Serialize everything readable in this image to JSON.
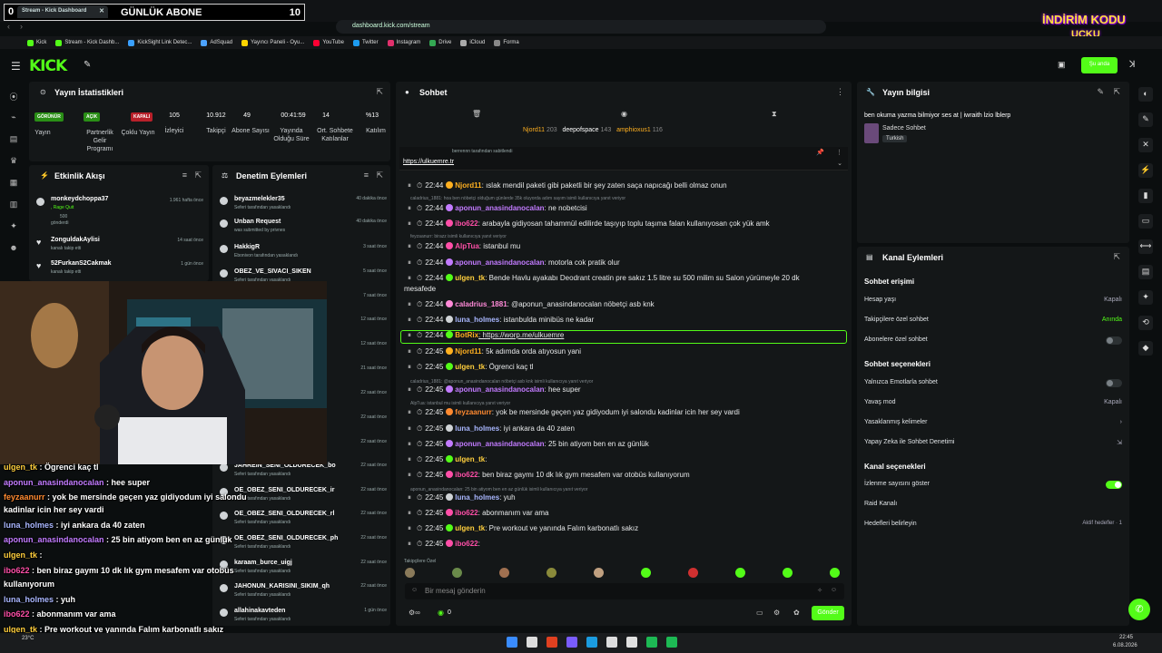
{
  "browser": {
    "tab_title": "Stream - Kick Dashboard",
    "goal_label": "GÜNLÜK ABONE",
    "goal_count": "10",
    "left_digit": "0",
    "url": "dashboard.kick.com/stream"
  },
  "promo": {
    "line1": "İNDİRİM KODU",
    "line2": "UCKU"
  },
  "bookmarks": [
    "Kick",
    "Stream - Kick Dashb...",
    "KickSight Link Detec...",
    "AdSquad",
    "Yayıncı Paneli - Oyu...",
    "YouTube",
    "Twitter",
    "Instagram",
    "Drive",
    "iCloud",
    "Forma"
  ],
  "header": {
    "logo": "KICK",
    "go_live": "Şu anda"
  },
  "stats": {
    "title": "Yayın İstatistikleri",
    "badges": [
      "GÖRÜNÜR",
      "AÇIK",
      "KAPALI"
    ],
    "labels": [
      "Yayın",
      "Partnerlik Gelir Programı",
      "Çoklu Yayın",
      "İzleyici",
      "Takipçi",
      "Abone Sayısı",
      "Yayında Olduğu Süre",
      "Ort. Sohbete Katılanlar",
      "Katılım"
    ],
    "values": [
      "105",
      "10.912",
      "49",
      "00:41:59",
      "14",
      "%13"
    ]
  },
  "activity": {
    "title": "Etkinlik Akışı",
    "items": [
      {
        "user": "monkeydchoppa37",
        "sub": ", Rage Quit",
        "extra": "500",
        "extra2": "gönderdi",
        "time": "1.961 hafta önce"
      },
      {
        "user": "ZonguldakAylisi",
        "sub": "kanalı takip etti",
        "time": "14 saat önce"
      },
      {
        "user": "52FurkanS2Cakmak",
        "sub": "kanalı takip etti",
        "time": "1 gün önce"
      }
    ]
  },
  "moderation": {
    "title": "Denetim Eylemleri",
    "items": [
      {
        "user": "beyazmelekler35",
        "sub": "Seferi tarafından yasaklandı",
        "time": "40 dakika önce"
      },
      {
        "user": "Unban Request",
        "sub": "was submitted by privnes",
        "time": "40 dakika önce"
      },
      {
        "user": "HakkigR",
        "sub": "Ebonivon tarafından yasaklandı",
        "time": "3 saat önce"
      },
      {
        "user": "OBEZ_VE_SIVACI_SIKEN",
        "sub": "Seferi tarafından yasaklandı",
        "time": "5 saat önce"
      },
      {
        "user": "",
        "sub": "",
        "time": "7 saat önce"
      },
      {
        "user": "",
        "sub": "",
        "time": "12 saat önce"
      },
      {
        "user": "",
        "sub": "",
        "time": "12 saat önce"
      },
      {
        "user": "",
        "sub": "",
        "time": "21 saat önce"
      },
      {
        "user": "",
        "sub": "",
        "time": "22 saat önce"
      },
      {
        "user": "",
        "sub": "",
        "time": "22 saat önce"
      },
      {
        "user": "",
        "sub": "",
        "time": "22 saat önce"
      },
      {
        "user": "JAHREIN_SENI_OLDURECEK_bo",
        "sub": "Seferi tarafından yasaklandı",
        "time": "22 saat önce"
      },
      {
        "user": "OE_OBEZ_SENI_OLDURECEK_ir",
        "sub": "Seferi tarafından yasaklandı",
        "time": "22 saat önce"
      },
      {
        "user": "OE_OBEZ_SENI_OLDURECEK_rl",
        "sub": "Seferi tarafından yasaklandı",
        "time": "22 saat önce"
      },
      {
        "user": "OE_OBEZ_SENI_OLDURECEK_ph",
        "sub": "Seferi tarafından yasaklandı",
        "time": "22 saat önce"
      },
      {
        "user": "karaam_burce_uigj",
        "sub": "Seferi tarafından yasaklandı",
        "time": "22 saat önce"
      },
      {
        "user": "JAHONUN_KARISINI_SIKIM_qh",
        "sub": "Seferi tarafından yasaklandı",
        "time": "22 saat önce"
      },
      {
        "user": "allahinakavteden",
        "sub": "Seferi tarafından yasaklandı",
        "time": "1 gün önce"
      }
    ]
  },
  "overlay_chat": [
    {
      "user": "ulgen_tk",
      "msg": " : Ögrenci kaç tl",
      "color": "#ffcf3d"
    },
    {
      "user": "aponun_anasindanocalan",
      "msg": " : hee super",
      "color": "#c27bff"
    },
    {
      "user": "feyzaanurr",
      "msg": " : yok be mersinde geçen yaz gidiyodum iyi salondu",
      "color": "#ff8a30"
    },
    {
      "user": "",
      "msg": "kadinlar icin her sey vardi",
      "color": "#fff"
    },
    {
      "user": "luna_holmes",
      "msg": " : iyi ankara da 40 zaten",
      "color": "#a9b7ff"
    },
    {
      "user": "aponun_anasindanocalan",
      "msg": " : 25 bin atiyom ben en az günlük",
      "color": "#c27bff"
    },
    {
      "user": "ulgen_tk",
      "msg": " : ",
      "color": "#ffcf3d"
    },
    {
      "user": "ibo622",
      "msg": " : ben biraz gaymı 10 dk lık gym mesafem var otobüs",
      "color": "#ff4fa8"
    },
    {
      "user": "",
      "msg": "kullanıyorum",
      "color": "#fff"
    },
    {
      "user": "luna_holmes",
      "msg": " : yuh",
      "color": "#a9b7ff"
    },
    {
      "user": "ibo622",
      "msg": " : abonmanım var ama",
      "color": "#ff4fa8"
    },
    {
      "user": "ulgen_tk",
      "msg": " : Pre workout ve yanında Falım karbonatlı sakız",
      "color": "#ffcf3d"
    }
  ],
  "chat": {
    "title": "Sohbet",
    "top_users": [
      {
        "name": "Njord11",
        "count": "203"
      },
      {
        "name": "deepofspace",
        "count": "143"
      },
      {
        "name": "amphioxus1",
        "count": "116"
      }
    ],
    "pinned_by": "berrennn tarafından sabitlendi",
    "pinned_link": "https://ulkuemre.tr",
    "messages": [
      {
        "time": "22:44",
        "user": "Njord11",
        "color": "#ffb020",
        "text": ": ıslak mendil paketi gibi paketli bir şey zaten saça napıcağı belli olmaz onun"
      },
      {
        "time": "22:44",
        "user": "aponun_anasindanocalan",
        "color": "#c27bff",
        "text": ": ne nobetcisi"
      },
      {
        "time": "22:44",
        "user": "ibo622",
        "color": "#ff4fa8",
        "text": ": arabayla gidiyosan tahammül edilirde taşıyıp toplu taşıma falan kullanıyosan çok yük amk"
      },
      {
        "time": "22:44",
        "user": "AlpTua",
        "color": "#ff4fa8",
        "text": ": istanbul mu"
      },
      {
        "time": "22:44",
        "user": "aponun_anasindanocalan",
        "color": "#c27bff",
        "text": ": motorla cok pratik olur"
      },
      {
        "time": "22:44",
        "user": "ulgen_tk",
        "color": "#ffcf3d",
        "text": ": Bende Havlu ayakabı Deodrant creatin pre sakız 1.5 litre su 500 milim su Salon yürümeyle 20 dk"
      },
      {
        "time": "",
        "user": "",
        "color": "#fff",
        "text": "mesafede"
      },
      {
        "time": "22:44",
        "user": "caladrius_1881",
        "color": "#ff8ad8",
        "text": ": @aponun_anasindanocalan nöbetçi asb knk"
      },
      {
        "time": "22:44",
        "user": "luna_holmes",
        "color": "#a9b7ff",
        "text": ": istanbulda minibüs ne kadar"
      },
      {
        "time": "22:44",
        "user": "BotRix",
        "color": "#ffb020",
        "text": ": https://worp.me/ulkuemre"
      },
      {
        "time": "22:45",
        "user": "Njord11",
        "color": "#ffb020",
        "text": ": 5k adımda orda atıyosun yani"
      },
      {
        "time": "22:45",
        "user": "ulgen_tk",
        "color": "#ffcf3d",
        "text": ": Ögrenci kaç tl"
      },
      {
        "time": "22:45",
        "user": "aponun_anasindanocalan",
        "color": "#c27bff",
        "text": ": hee super"
      },
      {
        "time": "22:45",
        "user": "feyzaanurr",
        "color": "#ff8a30",
        "text": ": yok be mersinde geçen yaz gidiyodum iyi salondu kadinlar icin her sey vardi"
      },
      {
        "time": "22:45",
        "user": "luna_holmes",
        "color": "#a9b7ff",
        "text": ": iyi ankara da 40 zaten"
      },
      {
        "time": "22:45",
        "user": "aponun_anasindanocalan",
        "color": "#c27bff",
        "text": ": 25 bin atiyom ben en az günlük"
      },
      {
        "time": "22:45",
        "user": "ulgen_tk",
        "color": "#ffcf3d",
        "text": ":"
      },
      {
        "time": "22:45",
        "user": "ibo622",
        "color": "#ff4fa8",
        "text": ": ben biraz gaymı 10 dk lık gym mesafem var otobüs kullanıyorum"
      },
      {
        "time": "22:45",
        "user": "luna_holmes",
        "color": "#a9b7ff",
        "text": ": yuh"
      },
      {
        "time": "22:45",
        "user": "ibo622",
        "color": "#ff4fa8",
        "text": ": abonmanım var ama"
      },
      {
        "time": "22:45",
        "user": "ulgen_tk",
        "color": "#ffcf3d",
        "text": ": Pre workout ve yanında Falım karbonatlı sakız"
      },
      {
        "time": "22:45",
        "user": "ibo622",
        "color": "#ff4fa8",
        "text": ":"
      }
    ],
    "sys_notes": [
      "caladrius_1881: hoa ben nöbetçi olduğum günlerde 35k oluyorda adım sayım isimli kullanıcıya yanıt veriyor",
      "feyzaanurr: birazz isimli kullanıcıya yanıt veriyor",
      "caladrius_1881: @aponun_anasindanocalan nöbetçi asb knk isimli kullanıcıya yanıt veriyor",
      "AlpTua: istanbul mu isimli kullanıcıya yanıt veriyor",
      "aponun_anasindanocalan: 25 bin atiyom ben en az günlük isimli kullanıcıya yanıt veriyor"
    ],
    "followers_only": "Takipçilere Özel",
    "input_placeholder": "Bir mesaj gönderin",
    "points": "0",
    "send_label": "Gönder"
  },
  "stream_info": {
    "title": "Yayın bilgisi",
    "stream_title": "ben okuma yazma bilmiyor ses at | iwraith lzio lblerp",
    "category": "Sadece Sohbet",
    "language": "Turkish"
  },
  "channel": {
    "title": "Kanal Eylemleri",
    "sec1": "Sohbet erişimi",
    "rows1": [
      {
        "label": "Hesap yaşı",
        "value": "Kapalı"
      },
      {
        "label": "Takipçilere özel sohbet",
        "value": "Anında"
      },
      {
        "label": "Abonelere özel sohbet",
        "value": ""
      }
    ],
    "sec2": "Sohbet seçenekleri",
    "rows2": [
      {
        "label": "Yalnızca Emotlarla sohbet",
        "value": ""
      },
      {
        "label": "Yavaş mod",
        "value": "Kapalı"
      },
      {
        "label": "Yasaklanmış kelimeler",
        "value": ""
      },
      {
        "label": "Yapay Zeka ile Sohbet Denetimi",
        "value": ""
      }
    ],
    "sec3": "Kanal seçenekleri",
    "rows3": [
      {
        "label": "İzlenme sayısını göster",
        "value": ""
      },
      {
        "label": "Raid Kanalı",
        "value": ""
      },
      {
        "label": "Hedefleri belirleyin",
        "value": "Aktif hedefler · 1"
      }
    ]
  },
  "taskbar": {
    "time": "22:45",
    "date": "6.08.2026",
    "weather": "23°C"
  }
}
